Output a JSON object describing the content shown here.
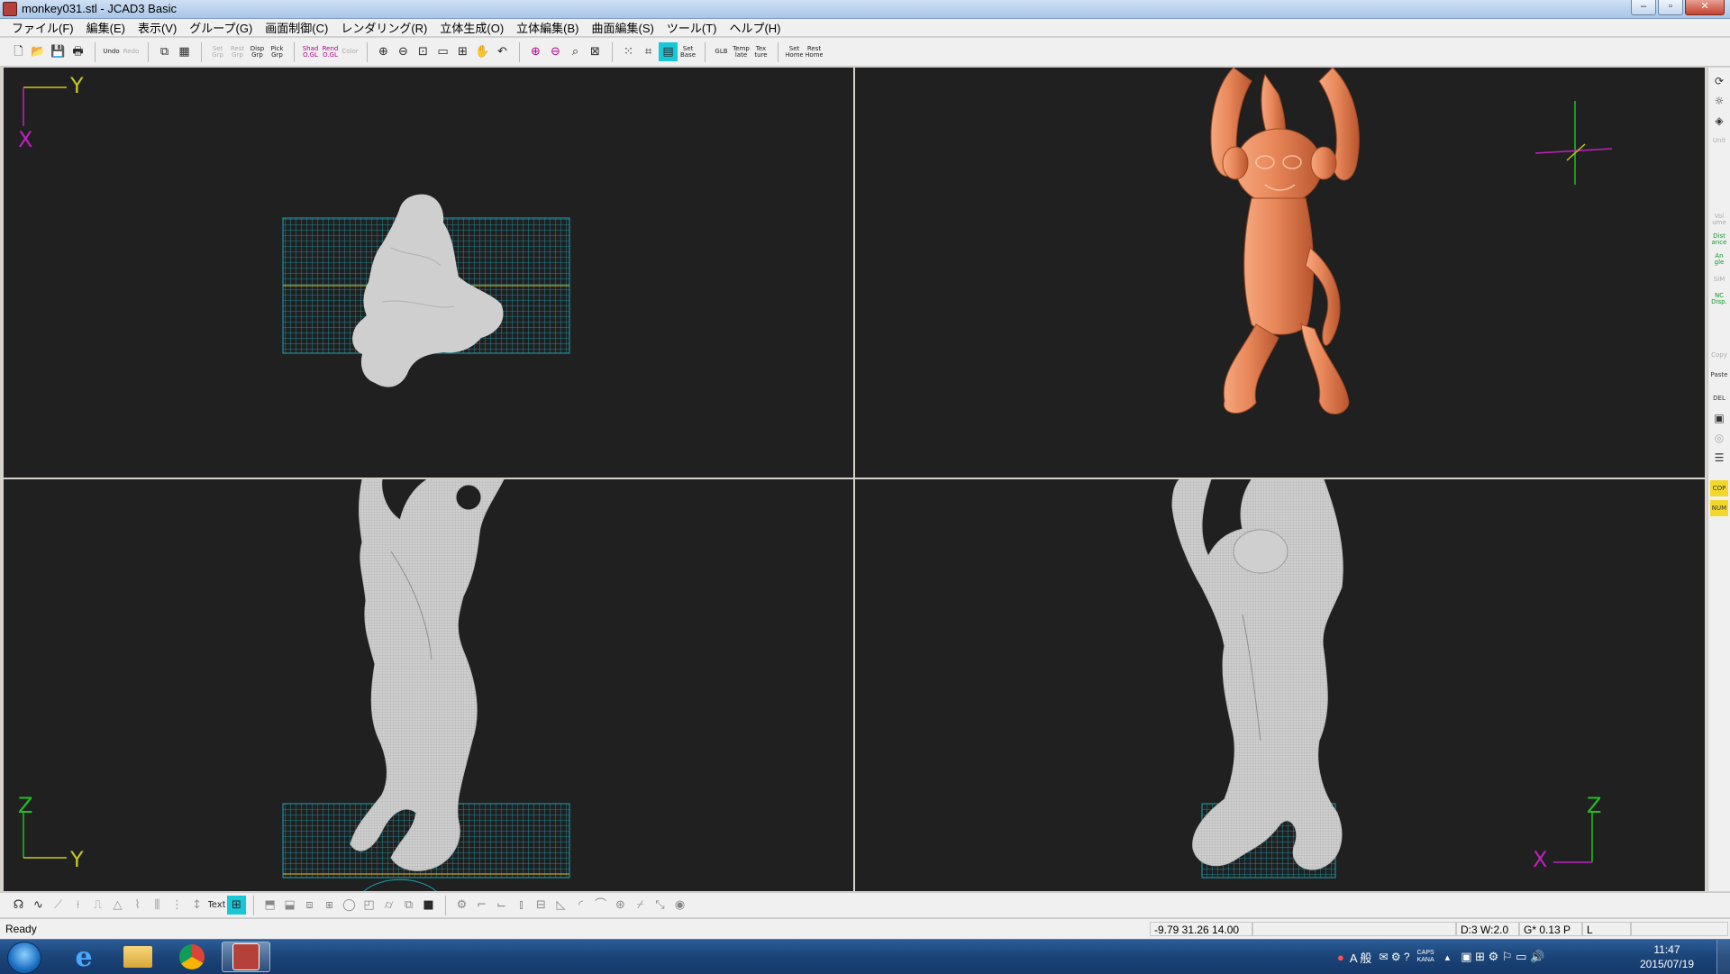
{
  "window": {
    "title": "monkey031.stl - JCAD3 Basic",
    "controls": [
      "–",
      "▫",
      "✕"
    ]
  },
  "menu": [
    "ファイル(F)",
    "編集(E)",
    "表示(V)",
    "グループ(G)",
    "画面制御(C)",
    "レンダリング(R)",
    "立体生成(O)",
    "立体編集(B)",
    "曲面編集(S)",
    "ツール(T)",
    "ヘルプ(H)"
  ],
  "toolbar": {
    "file": [
      "new",
      "open",
      "save",
      "print"
    ],
    "undo": "Undo",
    "redo": "Redo",
    "group": [
      "Set Grp",
      "Rest Grp",
      "Disp Grp",
      "Pick Grp"
    ],
    "shade": [
      "Shad O.GL",
      "Rend O.GL",
      "Color"
    ],
    "base": "Set Base",
    "glb": "GLB",
    "template": "Temp late",
    "texture": "Tex ture",
    "set_home": "Set Home",
    "rest_home": "Rest Home"
  },
  "viewports": {
    "top_left": {
      "axis_h": "Y",
      "axis_v": "X"
    },
    "bottom_left": {
      "axis_h": "Y",
      "axis_v": "Z"
    },
    "bottom_right": {
      "axis_h": "X",
      "axis_v": "Z"
    }
  },
  "sidebar": {
    "items": [
      "Vol ume",
      "Dist ance",
      "An gle",
      "SIM",
      "NC Disp.",
      "Copy",
      "Paste",
      "DEL",
      "COP",
      "NUM"
    ]
  },
  "bottom_toolbar": {
    "text_button": "Text"
  },
  "status": {
    "ready": "Ready",
    "coords": "-9.79 31.26 14.00",
    "info": "D:3 W:2.0",
    "grid": "G* 0.13 P",
    "mode": "L"
  },
  "taskbar": {
    "time": "11:47",
    "date": "2015/07/19",
    "ime": "A 般",
    "caps": "CAPS",
    "kana": "KANA"
  },
  "colors": {
    "viewport_bg": "#202020",
    "grid": "#1aa5b5",
    "mesh": "#cfcfcf",
    "render": "#e8875a",
    "axis_yellow": "#c8c820",
    "axis_magenta": "#c020c0",
    "axis_green": "#20c020"
  }
}
